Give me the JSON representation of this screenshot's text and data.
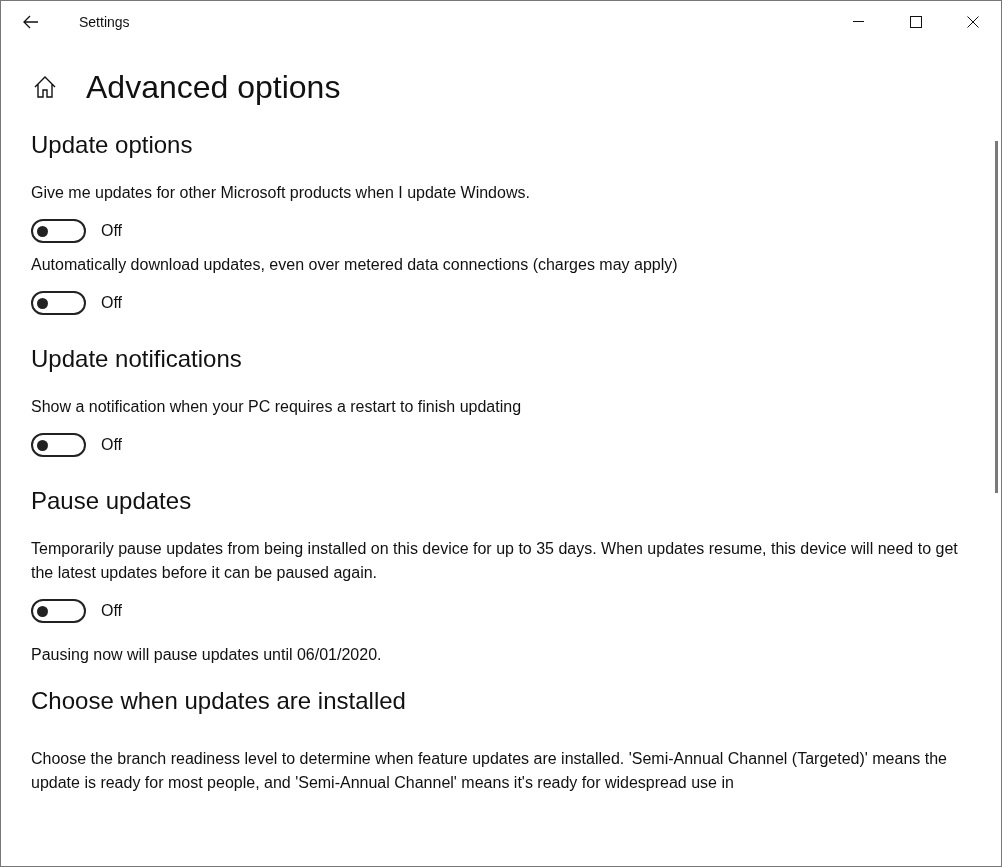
{
  "window": {
    "title": "Settings"
  },
  "page": {
    "title": "Advanced options"
  },
  "sections": [
    {
      "heading": "Update options",
      "items": [
        {
          "kind": "toggle",
          "label": "Give me updates for other Microsoft products when I update Windows.",
          "on": false,
          "state_text": "Off"
        },
        {
          "kind": "toggle",
          "label": "Automatically download updates, even over metered data connections (charges may apply)",
          "on": false,
          "state_text": "Off"
        }
      ]
    },
    {
      "heading": "Update notifications",
      "items": [
        {
          "kind": "toggle",
          "label": "Show a notification when your PC requires a restart to finish updating",
          "on": false,
          "state_text": "Off"
        }
      ]
    },
    {
      "heading": "Pause updates",
      "items": [
        {
          "kind": "toggle",
          "label": "Temporarily pause updates from being installed on this device for up to 35 days. When updates resume, this device will need to get the latest updates before it can be paused again.",
          "on": false,
          "state_text": "Off"
        },
        {
          "kind": "text",
          "text": "Pausing now will pause updates until 06/01/2020."
        }
      ]
    },
    {
      "heading": "Choose when updates are installed",
      "items": [
        {
          "kind": "text",
          "text": "Choose the branch readiness level to determine when feature updates are installed. 'Semi-Annual Channel (Targeted)' means the update is ready for most people, and 'Semi-Annual Channel' means it's ready for widespread use in"
        }
      ]
    }
  ]
}
